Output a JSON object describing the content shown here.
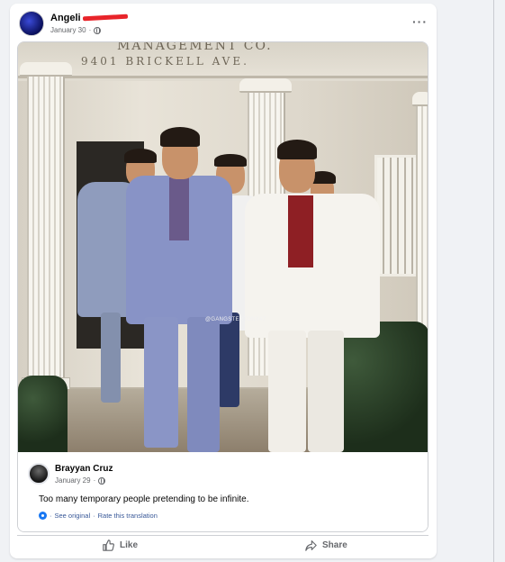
{
  "post": {
    "author": "Angeli",
    "date": "January 30",
    "date_sep": "·",
    "more_label": "···"
  },
  "photo": {
    "sign_text": "9401  BRICKELL  AVE.",
    "sign_top": "MANAGEMENT CO.",
    "watermark": "@GANGSTERTONY47"
  },
  "quoted": {
    "author": "Brayyan Cruz",
    "date": "January 29",
    "date_sep": "·",
    "text": "Too many temporary people pretending to be infinite.",
    "see_original": "See original",
    "sep": "·",
    "rate_translation": "Rate this translation"
  },
  "actions": {
    "like": "Like",
    "share": "Share"
  },
  "colors": {
    "accent": "#1877f2",
    "link": "#385898",
    "redaction": "#e8242a"
  }
}
